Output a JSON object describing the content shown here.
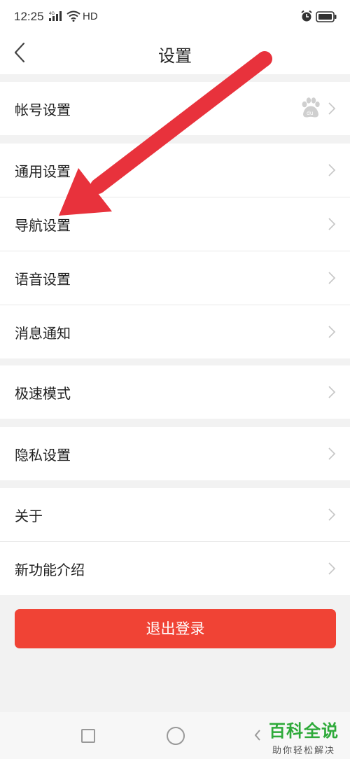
{
  "status_bar": {
    "time": "12:25",
    "network": "4G",
    "hd": "HD"
  },
  "nav": {
    "title": "设置"
  },
  "groups": [
    {
      "items": [
        {
          "label": "帐号设置",
          "trailing_icon": "baidu-paw-icon"
        }
      ]
    },
    {
      "items": [
        {
          "label": "通用设置"
        },
        {
          "label": "导航设置"
        },
        {
          "label": "语音设置"
        },
        {
          "label": "消息通知"
        }
      ]
    },
    {
      "items": [
        {
          "label": "极速模式"
        }
      ]
    },
    {
      "items": [
        {
          "label": "隐私设置"
        }
      ]
    },
    {
      "items": [
        {
          "label": "关于"
        },
        {
          "label": "新功能介绍"
        }
      ]
    }
  ],
  "logout": {
    "label": "退出登录"
  },
  "watermark": {
    "title": "百科全说",
    "subtitle": "助你轻松解决"
  },
  "colors": {
    "accent_red": "#f04335",
    "arrow_red": "#e8323c",
    "watermark_green": "#2eaa3a",
    "background": "#f2f2f2"
  }
}
